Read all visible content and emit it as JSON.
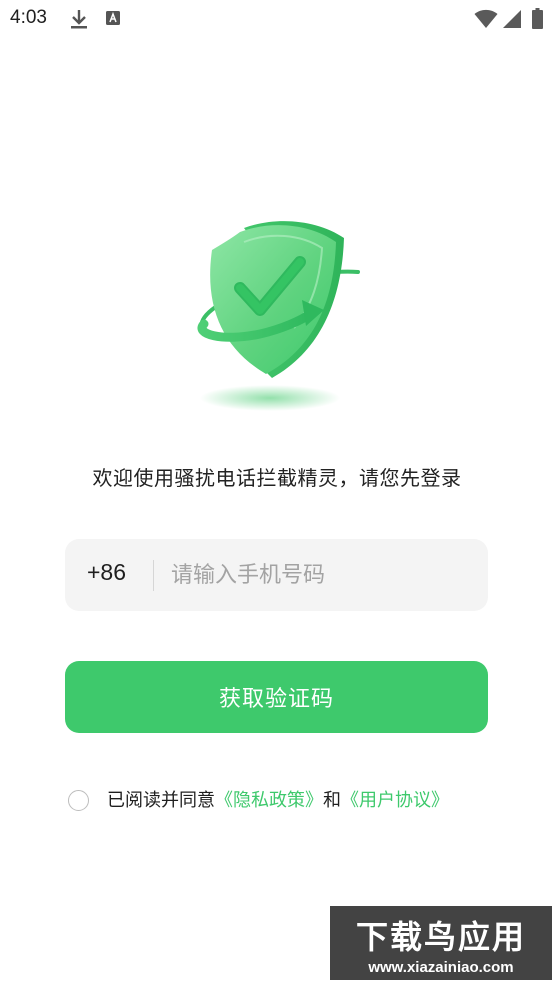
{
  "status_bar": {
    "time": "4:03",
    "icons": [
      "download-icon",
      "a-letter-icon",
      "wifi-icon",
      "signal-icon",
      "battery-icon"
    ]
  },
  "hero": {
    "illustration": "green-shield-check-icon"
  },
  "welcome": {
    "text": "欢迎使用骚扰电话拦截精灵，请您先登录"
  },
  "login": {
    "country_code": "+86",
    "phone_placeholder": "请输入手机号码",
    "phone_value": "",
    "get_code_label": "获取验证码"
  },
  "agreement": {
    "checked": false,
    "prefix": "已阅读并同意",
    "privacy_link": "《隐私政策》",
    "connector": "和",
    "user_agreement_link": "《用户协议》"
  },
  "watermark": {
    "title": "下载鸟应用",
    "url": "www.xiazainiao.com"
  },
  "colors": {
    "accent": "#3ec96c",
    "input_background": "#f4f4f4",
    "placeholder": "#a3a3a3",
    "text": "#1f1f1f"
  }
}
